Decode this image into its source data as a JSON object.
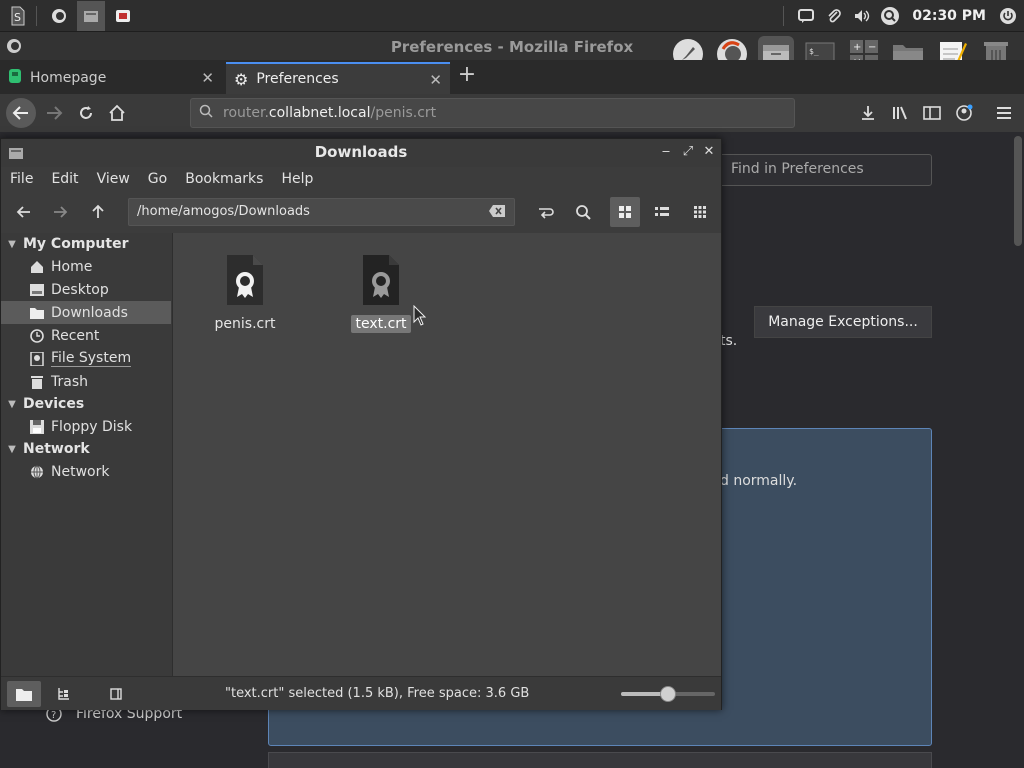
{
  "panel": {
    "clock": "02:30 PM"
  },
  "firefox": {
    "window_title": "Preferences - Mozilla Firefox",
    "tabs": [
      {
        "label": "Homepage"
      },
      {
        "label": "Preferences"
      }
    ],
    "url": {
      "scheme_prefix": "router.",
      "host": "collabnet.local",
      "path": "/penis.crt"
    },
    "prefs": {
      "find_placeholder": "Find in Preferences",
      "manage_exceptions": "Manage Exceptions...",
      "partial_text_1": "ts.",
      "partial_text_2": "d normally.",
      "support_link": "Firefox Support"
    }
  },
  "file_manager": {
    "title": "Downloads",
    "menu": [
      "File",
      "Edit",
      "View",
      "Go",
      "Bookmarks",
      "Help"
    ],
    "path": "/home/amogos/Downloads",
    "sidebar": {
      "sections": [
        {
          "label": "My Computer",
          "items": [
            "Home",
            "Desktop",
            "Downloads",
            "Recent",
            "File System",
            "Trash"
          ]
        },
        {
          "label": "Devices",
          "items": [
            "Floppy Disk"
          ]
        },
        {
          "label": "Network",
          "items": [
            "Network"
          ]
        }
      ],
      "selected": "Downloads"
    },
    "files": [
      {
        "name": "penis.crt",
        "selected": false
      },
      {
        "name": "text.crt",
        "selected": true
      }
    ],
    "status": "\"text.crt\" selected (1.5 kB), Free space: 3.6 GB",
    "zoom_level": 0.5
  },
  "colors": {
    "accent_blue": "#4a8ef0",
    "selection": "#5b5b5b"
  }
}
